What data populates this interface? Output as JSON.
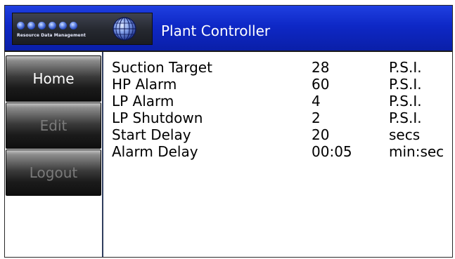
{
  "header": {
    "logo_text": "Resource Data Management",
    "title": "Plant Controller",
    "logo_icon": "globe-icon",
    "colors": {
      "header_blue": "#0e28c6",
      "logo_panel": "#25282f"
    }
  },
  "sidebar": {
    "items": [
      {
        "label": "Home",
        "state": "active"
      },
      {
        "label": "Edit",
        "state": "disabled"
      },
      {
        "label": "Logout",
        "state": "disabled"
      }
    ]
  },
  "settings": {
    "rows": [
      {
        "label": "Suction Target",
        "value": "28",
        "unit": "P.S.I."
      },
      {
        "label": "HP Alarm",
        "value": "60",
        "unit": "P.S.I."
      },
      {
        "label": "LP Alarm",
        "value": "4",
        "unit": "P.S.I."
      },
      {
        "label": "LP Shutdown",
        "value": "2",
        "unit": "P.S.I."
      },
      {
        "label": "Start Delay",
        "value": "20",
        "unit": "secs"
      },
      {
        "label": "Alarm Delay",
        "value": "00:05",
        "unit": "min:sec"
      }
    ]
  }
}
